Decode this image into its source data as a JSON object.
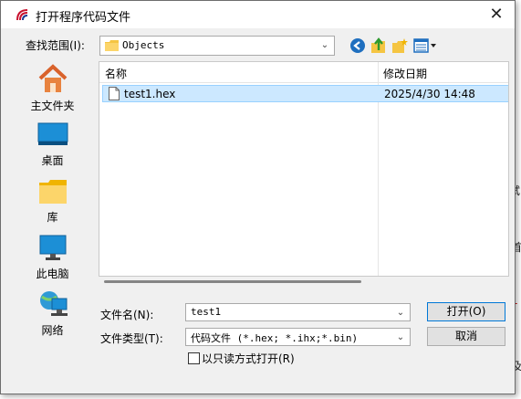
{
  "dialog": {
    "title": "打开程序代码文件",
    "close_glyph": "✕"
  },
  "lookin": {
    "label": "查找范围(I):",
    "value": "Objects"
  },
  "places": [
    {
      "label": "主文件夹",
      "icon": "home-icon"
    },
    {
      "label": "桌面",
      "icon": "desktop-icon"
    },
    {
      "label": "库",
      "icon": "library-icon"
    },
    {
      "label": "此电脑",
      "icon": "computer-icon"
    },
    {
      "label": "网络",
      "icon": "network-icon"
    }
  ],
  "filelist": {
    "columns": [
      "名称",
      "修改日期"
    ],
    "rows": [
      {
        "name": "test1.hex",
        "date": "2025/4/30 14:48"
      }
    ]
  },
  "filename": {
    "label": "文件名(N):",
    "value": "test1"
  },
  "filetype": {
    "label": "文件类型(T):",
    "value": "代码文件 (*.hex; *.ihx;*.bin)"
  },
  "readonly": {
    "label": "以只读方式打开(R)"
  },
  "buttons": {
    "open": "打开(O)",
    "cancel": "取消"
  },
  "colors": {
    "selection": "#cce8ff",
    "selection_border": "#99d1ff",
    "open_border": "#0078d7"
  }
}
